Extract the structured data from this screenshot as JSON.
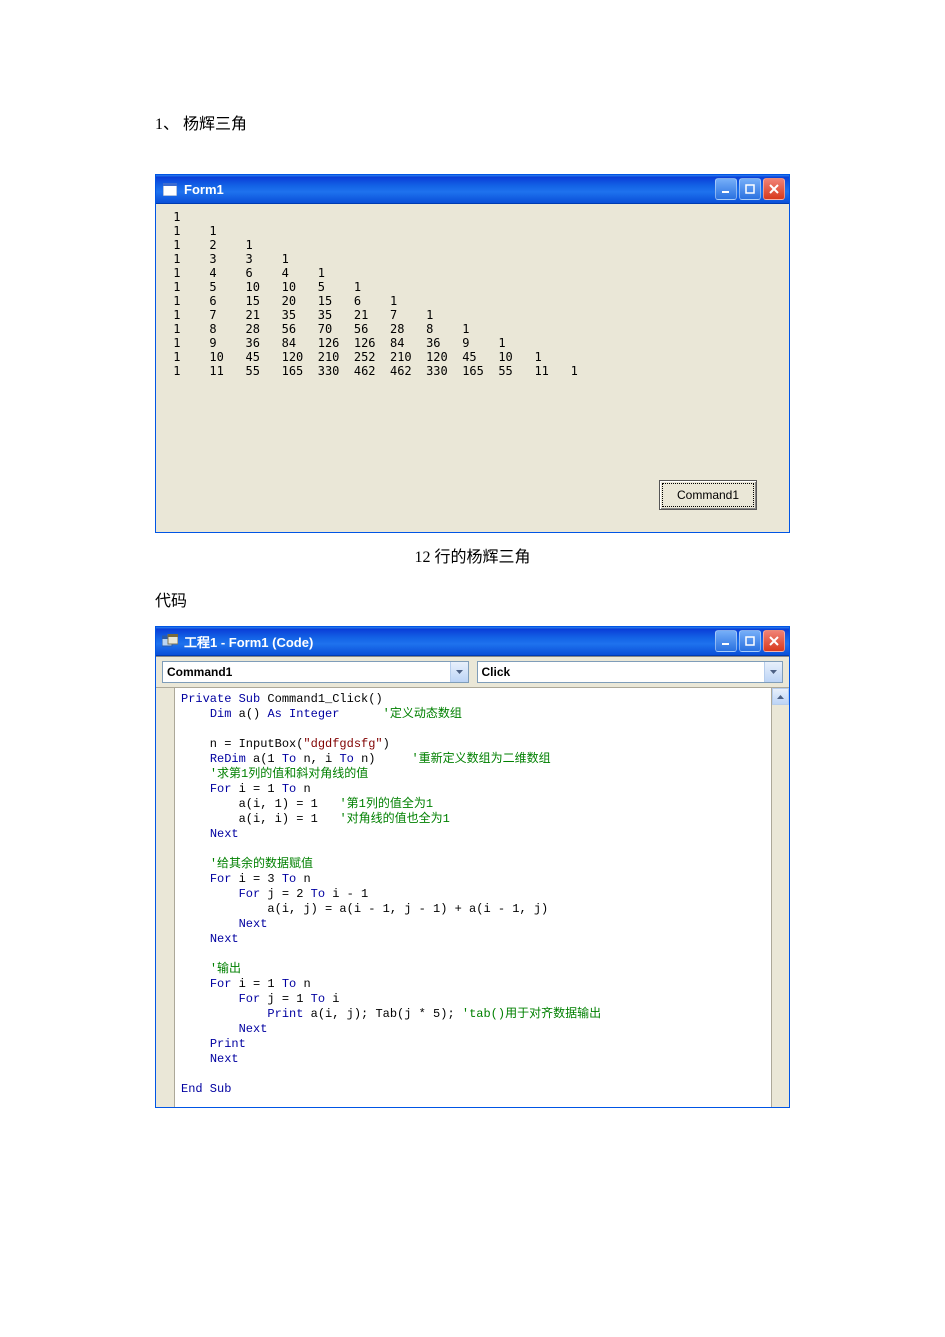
{
  "doc": {
    "heading": "1、 杨辉三角",
    "caption": "12 行的杨辉三角",
    "code_label": "代码"
  },
  "form_window": {
    "title": "Form1",
    "button_label": "Command1",
    "triangle_rows": [
      [
        1
      ],
      [
        1,
        1
      ],
      [
        1,
        2,
        1
      ],
      [
        1,
        3,
        3,
        1
      ],
      [
        1,
        4,
        6,
        4,
        1
      ],
      [
        1,
        5,
        10,
        10,
        5,
        1
      ],
      [
        1,
        6,
        15,
        20,
        15,
        6,
        1
      ],
      [
        1,
        7,
        21,
        35,
        35,
        21,
        7,
        1
      ],
      [
        1,
        8,
        28,
        56,
        70,
        56,
        28,
        8,
        1
      ],
      [
        1,
        9,
        36,
        84,
        126,
        126,
        84,
        36,
        9,
        1
      ],
      [
        1,
        10,
        45,
        120,
        210,
        252,
        210,
        120,
        45,
        10,
        1
      ],
      [
        1,
        11,
        55,
        165,
        330,
        462,
        462,
        330,
        165,
        55,
        11,
        1
      ]
    ]
  },
  "code_window": {
    "title": "工程1 - Form1 (Code)",
    "combo_object": "Command1",
    "combo_proc": "Click",
    "code_tokens": [
      [
        {
          "t": "Private Sub",
          "c": "kw"
        },
        {
          "t": " Command1_Click()"
        }
      ],
      [
        {
          "t": "    "
        },
        {
          "t": "Dim",
          "c": "kw"
        },
        {
          "t": " a() "
        },
        {
          "t": "As Integer",
          "c": "kw"
        },
        {
          "t": "      "
        },
        {
          "t": "'定义动态数组",
          "c": "cm"
        }
      ],
      [
        {
          "t": ""
        }
      ],
      [
        {
          "t": "    n = InputBox("
        },
        {
          "t": "\"dgdfgdsfg\"",
          "c": "lit"
        },
        {
          "t": ")"
        }
      ],
      [
        {
          "t": "    "
        },
        {
          "t": "ReDim",
          "c": "kw"
        },
        {
          "t": " a(1 "
        },
        {
          "t": "To",
          "c": "kw"
        },
        {
          "t": " n, i "
        },
        {
          "t": "To",
          "c": "kw"
        },
        {
          "t": " n)     "
        },
        {
          "t": "'重新定义数组为二维数组",
          "c": "cm"
        }
      ],
      [
        {
          "t": "    "
        },
        {
          "t": "'求第1列的值和斜对角线的值",
          "c": "cm"
        }
      ],
      [
        {
          "t": "    "
        },
        {
          "t": "For",
          "c": "kw"
        },
        {
          "t": " i = 1 "
        },
        {
          "t": "To",
          "c": "kw"
        },
        {
          "t": " n"
        }
      ],
      [
        {
          "t": "        a(i, 1) = 1   "
        },
        {
          "t": "'第1列的值全为1",
          "c": "cm"
        }
      ],
      [
        {
          "t": "        a(i, i) = 1   "
        },
        {
          "t": "'对角线的值也全为1",
          "c": "cm"
        }
      ],
      [
        {
          "t": "    "
        },
        {
          "t": "Next",
          "c": "kw"
        }
      ],
      [
        {
          "t": ""
        }
      ],
      [
        {
          "t": "    "
        },
        {
          "t": "'给其余的数据赋值",
          "c": "cm"
        }
      ],
      [
        {
          "t": "    "
        },
        {
          "t": "For",
          "c": "kw"
        },
        {
          "t": " i = 3 "
        },
        {
          "t": "To",
          "c": "kw"
        },
        {
          "t": " n"
        }
      ],
      [
        {
          "t": "        "
        },
        {
          "t": "For",
          "c": "kw"
        },
        {
          "t": " j = 2 "
        },
        {
          "t": "To",
          "c": "kw"
        },
        {
          "t": " i - 1"
        }
      ],
      [
        {
          "t": "            a(i, j) = a(i - 1, j - 1) + a(i - 1, j)"
        }
      ],
      [
        {
          "t": "        "
        },
        {
          "t": "Next",
          "c": "kw"
        }
      ],
      [
        {
          "t": "    "
        },
        {
          "t": "Next",
          "c": "kw"
        }
      ],
      [
        {
          "t": ""
        }
      ],
      [
        {
          "t": "    "
        },
        {
          "t": "'输出",
          "c": "cm"
        }
      ],
      [
        {
          "t": "    "
        },
        {
          "t": "For",
          "c": "kw"
        },
        {
          "t": " i = 1 "
        },
        {
          "t": "To",
          "c": "kw"
        },
        {
          "t": " n"
        }
      ],
      [
        {
          "t": "        "
        },
        {
          "t": "For",
          "c": "kw"
        },
        {
          "t": " j = 1 "
        },
        {
          "t": "To",
          "c": "kw"
        },
        {
          "t": " i"
        }
      ],
      [
        {
          "t": "            "
        },
        {
          "t": "Print",
          "c": "kw"
        },
        {
          "t": " a(i, j); Tab(j * 5); "
        },
        {
          "t": "'tab()用于对齐数据输出",
          "c": "cm"
        }
      ],
      [
        {
          "t": "        "
        },
        {
          "t": "Next",
          "c": "kw"
        }
      ],
      [
        {
          "t": "    "
        },
        {
          "t": "Print",
          "c": "kw"
        }
      ],
      [
        {
          "t": "    "
        },
        {
          "t": "Next",
          "c": "kw"
        }
      ],
      [
        {
          "t": ""
        }
      ],
      [
        {
          "t": "End Sub",
          "c": "kw"
        }
      ]
    ]
  }
}
